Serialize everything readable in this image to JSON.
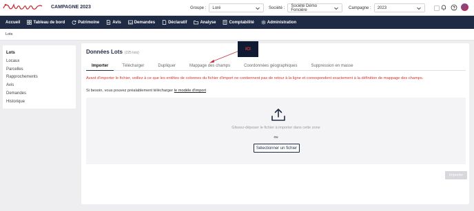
{
  "header": {
    "campagne_title": "CAMPAGNE 2023",
    "groupe_label": "Groupe :",
    "groupe_value": "Loré",
    "societe_label": "Société :",
    "societe_value": "Société Démo Foncière",
    "campagne_label": "Campagne :",
    "campagne_value": "2023",
    "icons": [
      "chat-icon",
      "bell-icon",
      "help-icon",
      "avatar"
    ]
  },
  "nav": {
    "items": [
      {
        "label": "Accueil",
        "icon": ""
      },
      {
        "label": "Tableau de bord",
        "icon": "dashboard-icon"
      },
      {
        "label": "Patrimoine",
        "icon": "refresh-icon"
      },
      {
        "label": "Avis",
        "icon": "document-icon"
      },
      {
        "label": "Demandes",
        "icon": "inbox-icon"
      },
      {
        "label": "Déclaratif",
        "icon": "file-icon"
      },
      {
        "label": "Analyse",
        "icon": "folder-icon"
      },
      {
        "label": "Comptabilité",
        "icon": "calculator-icon"
      },
      {
        "label": "Administration",
        "icon": "gear-icon"
      }
    ]
  },
  "breadcrumb": "Lots",
  "sidebar": {
    "items": [
      {
        "label": "Lots",
        "active": true
      },
      {
        "label": "Locaux"
      },
      {
        "label": "Parcelles"
      },
      {
        "label": "Rapprochements"
      },
      {
        "label": "Avis"
      },
      {
        "label": "Demandes"
      },
      {
        "label": "Historique"
      }
    ]
  },
  "main": {
    "title": "Données Lots",
    "count": "(225 lots)",
    "tabs": [
      {
        "label": "Importer",
        "active": true
      },
      {
        "label": "Télécharger"
      },
      {
        "label": "Dupliquer"
      },
      {
        "label": "Mappage des champs"
      },
      {
        "label": "Coordonnées géographiques"
      },
      {
        "label": "Suppression en masse"
      }
    ],
    "warning": "Avant d'importer le fichier, veillez à ce que les entêtes de colonnes du fichier d'import ne contiennent pas de retour à la ligne et correspondent exactement à la définition de mappage des champs.",
    "hint_prefix": "Si besoin, vous pouvez préalablement télécharger ",
    "hint_link": "le modèle d'import",
    "dropzone_text": "Glissez-déposer le fichier à importer dans cette zone",
    "dropzone_or": "ou",
    "select_file_button": "Sélectionner un fichier",
    "import_button": "Importer"
  },
  "annotation": {
    "callout_label": "ICI"
  },
  "colors": {
    "navbar": "#1f2a44",
    "warning": "#d0342c",
    "brand": "#c8303a"
  }
}
